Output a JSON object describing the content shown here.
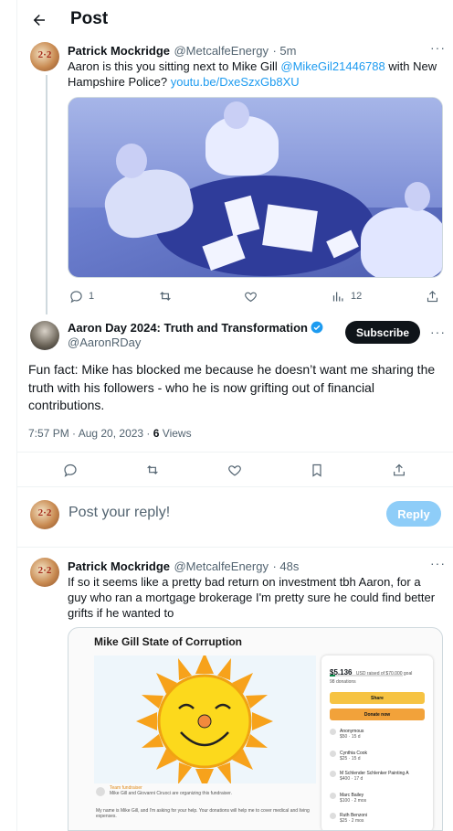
{
  "header": {
    "title": "Post"
  },
  "tweet1": {
    "name": "Patrick Mockridge",
    "handle": "@MetcalfeEnergy",
    "time": "· 5m",
    "text_before": "Aaron is this you sitting next to Mike Gill ",
    "mention": "@MikeGil21446788",
    "text_middle": "  with New Hampshire Police? ",
    "link": "youtu.be/DxeSzxGb8XU",
    "replies": "1",
    "views": "12"
  },
  "main_tweet": {
    "name": "Aaron Day 2024: Truth and Transformation",
    "handle": "@AaronRDay",
    "subscribe": "Subscribe",
    "text": "Fun fact: Mike has blocked me because he doesn’t want me sharing the truth with his followers - who he is now grifting out of financial contributions.",
    "timestamp": "7:57 PM · Aug 20, 2023 · ",
    "views_count": "6",
    "views_label": " Views"
  },
  "reply_box": {
    "placeholder": "Post your reply!",
    "button": "Reply"
  },
  "tweet3": {
    "name": "Patrick Mockridge",
    "handle": "@MetcalfeEnergy",
    "time": "· 48s",
    "text": "If so it seems like a pretty bad return on investment tbh Aaron, for a guy who ran a mortgage brokerage I'm pretty sure he could find better grifts if he wanted to"
  },
  "fundraiser": {
    "title": "Mike Gill State of Corruption",
    "raised": "$5,136",
    "raised_sub": "USD raised of $70,000 goal",
    "donations": "98 donations",
    "share": "Share",
    "donate": "Donate now",
    "organizer_label": "Team fundraiser",
    "organizer_text": "Mike Gill and Giovanni Ciruoci are organizing this fundraiser.",
    "desc": "My name is Mike Gill, and I'm asking for your help. Your donations will help me to cover medical and living expenses.",
    "donors": [
      {
        "name": "Anonymous",
        "amount": "$50 · 15 d"
      },
      {
        "name": "Cynthia Cook",
        "amount": "$25 · 15 d"
      },
      {
        "name": "M Schlender Schlenker Painting A",
        "amount": "$400 · 17 d"
      },
      {
        "name": "Marc Bailey",
        "amount": "$100 · 2 mos"
      },
      {
        "name": "Ruth Benzoni",
        "amount": "$25 · 2 mos"
      }
    ]
  },
  "colors": {
    "accent": "#1d9bf0",
    "reply_disabled": "#8ecdf8",
    "text": "#0f1419",
    "muted": "#536471"
  }
}
